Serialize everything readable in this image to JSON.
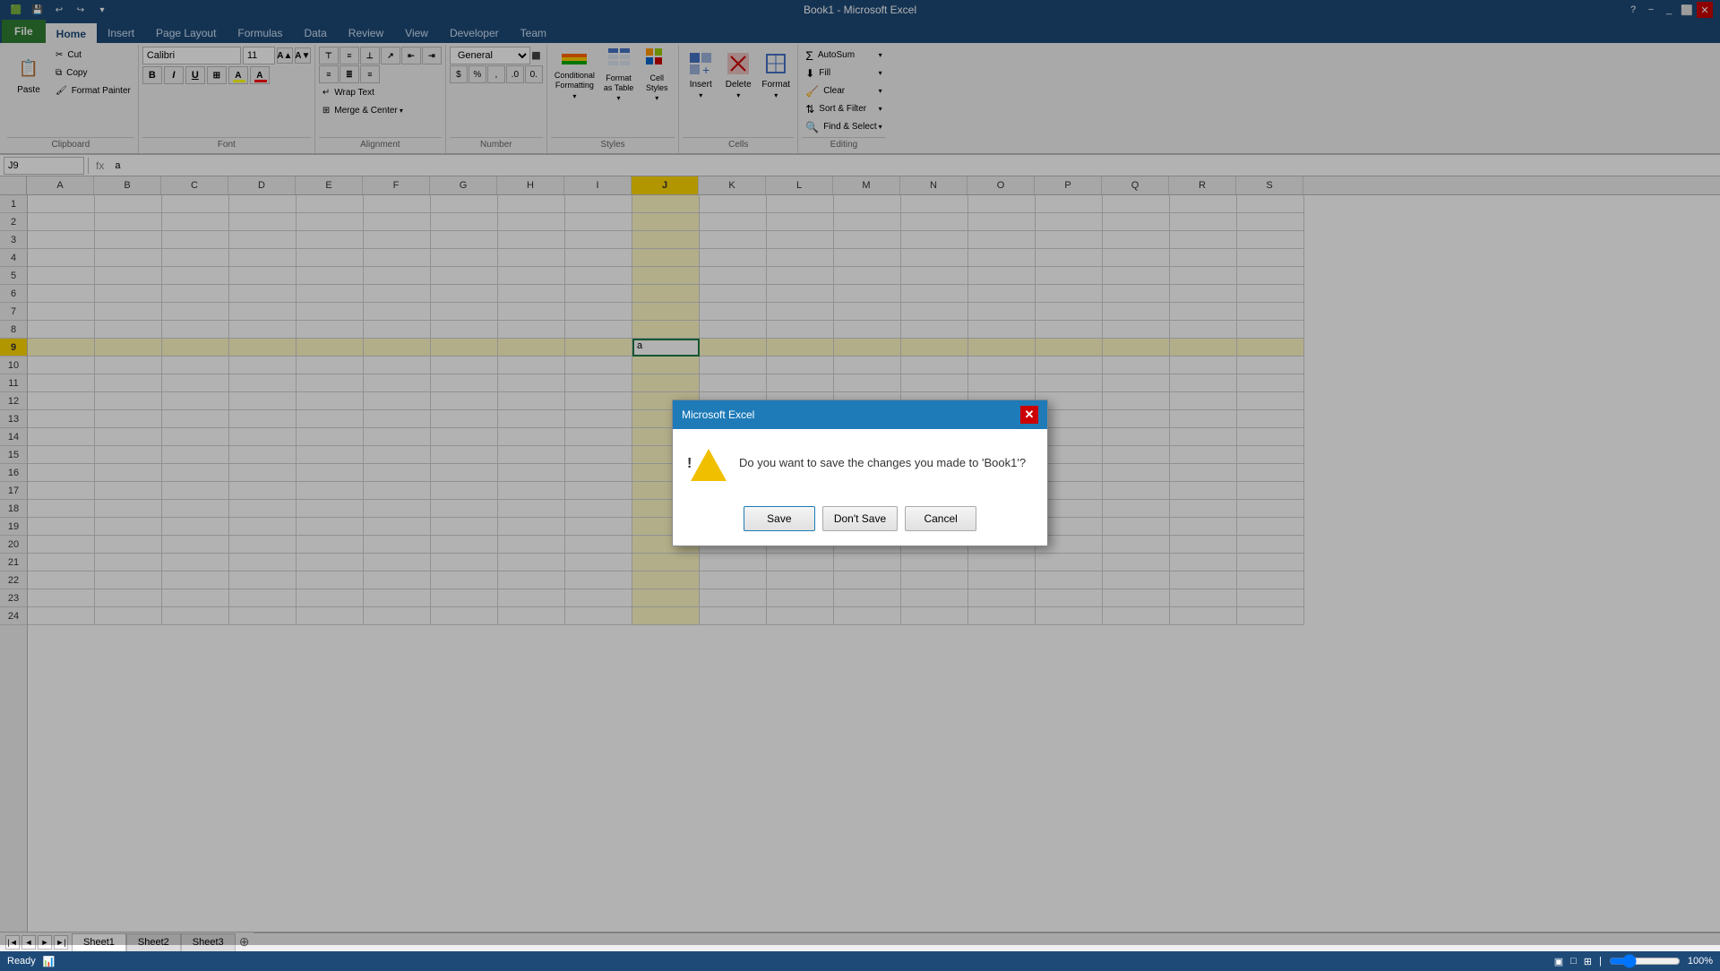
{
  "titleBar": {
    "title": "Book1 - Microsoft Excel",
    "quickAccess": [
      "save",
      "undo",
      "redo",
      "customize"
    ],
    "windowBtns": [
      "minimize",
      "restore",
      "close"
    ]
  },
  "ribbon": {
    "tabs": [
      "File",
      "Home",
      "Insert",
      "Page Layout",
      "Formulas",
      "Data",
      "Review",
      "View",
      "Developer",
      "Team"
    ],
    "activeTab": "Home",
    "groups": {
      "clipboard": {
        "label": "Clipboard",
        "paste": "Paste",
        "cut": "Cut",
        "copy": "Copy",
        "formatPainter": "Format Painter"
      },
      "font": {
        "label": "Font",
        "fontName": "Calibri",
        "fontSize": "11",
        "bold": "B",
        "italic": "I",
        "underline": "U"
      },
      "alignment": {
        "label": "Alignment",
        "wrapText": "Wrap Text",
        "mergecenter": "Merge & Center"
      },
      "number": {
        "label": "Number",
        "format": "General"
      },
      "styles": {
        "label": "Styles",
        "conditionalFormatting": "Conditional Formatting",
        "formatAsTable": "Format as Table",
        "cellStyles": "Cell Styles"
      },
      "cells": {
        "label": "Cells",
        "insert": "Insert",
        "delete": "Delete",
        "format": "Format"
      },
      "editing": {
        "label": "Editing",
        "autosum": "AutoSum",
        "fill": "Fill",
        "clear": "Clear",
        "sort": "Sort & Filter",
        "findSelect": "Find & Select"
      }
    }
  },
  "formulaBar": {
    "nameBox": "J9",
    "formula": "a"
  },
  "columns": [
    "A",
    "B",
    "C",
    "D",
    "E",
    "F",
    "G",
    "H",
    "I",
    "J",
    "K",
    "L",
    "M",
    "N",
    "O",
    "P",
    "Q",
    "R",
    "S"
  ],
  "rows": [
    "1",
    "2",
    "3",
    "4",
    "5",
    "6",
    "7",
    "8",
    "9",
    "10",
    "11",
    "12",
    "13",
    "14",
    "15",
    "16",
    "17",
    "18",
    "19",
    "20",
    "21",
    "22",
    "23",
    "24"
  ],
  "activeCell": {
    "row": 9,
    "col": "J"
  },
  "sheets": [
    "Sheet1",
    "Sheet2",
    "Sheet3"
  ],
  "activeSheet": "Sheet1",
  "statusBar": {
    "status": "Ready",
    "zoom": "100%",
    "viewBtns": [
      "Normal",
      "Page Layout",
      "Page Break Preview"
    ]
  },
  "dialog": {
    "title": "Microsoft Excel",
    "message": "Do you want to save the changes you made to 'Book1'?",
    "buttons": [
      "Save",
      "Don't Save",
      "Cancel"
    ]
  }
}
